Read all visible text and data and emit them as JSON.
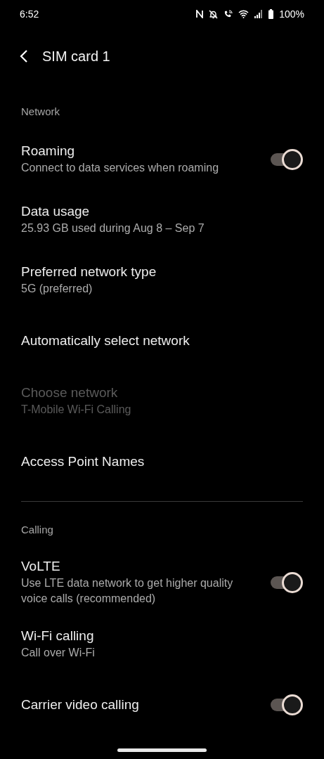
{
  "status_bar": {
    "time": "6:52",
    "battery": "100%"
  },
  "header": {
    "title": "SIM card 1"
  },
  "sections": [
    {
      "heading": "Network",
      "divider": false,
      "items": [
        {
          "kind": "switch",
          "title": "Roaming",
          "subtitle": "Connect to data services when roaming",
          "on": true,
          "disabled": false
        },
        {
          "kind": "plain",
          "title": "Data usage",
          "subtitle": "25.93 GB used during Aug 8 – Sep 7",
          "disabled": false
        },
        {
          "kind": "plain",
          "title": "Preferred network type",
          "subtitle": "5G (preferred)",
          "disabled": false
        },
        {
          "kind": "plain",
          "title": "Automatically select network",
          "disabled": false
        },
        {
          "kind": "plain",
          "title": "Choose network",
          "subtitle": "T-Mobile Wi-Fi Calling",
          "disabled": true
        },
        {
          "kind": "plain",
          "title": "Access Point Names",
          "disabled": false
        }
      ]
    },
    {
      "heading": "Calling",
      "divider": true,
      "items": [
        {
          "kind": "switch",
          "title": "VoLTE",
          "subtitle": "Use LTE data network to get higher quality voice calls (recommended)",
          "on": true,
          "disabled": false
        },
        {
          "kind": "plain",
          "title": "Wi-Fi calling",
          "subtitle": "Call over Wi-Fi",
          "disabled": false
        },
        {
          "kind": "switch",
          "title": "Carrier video calling",
          "on": true,
          "disabled": false
        }
      ]
    }
  ]
}
